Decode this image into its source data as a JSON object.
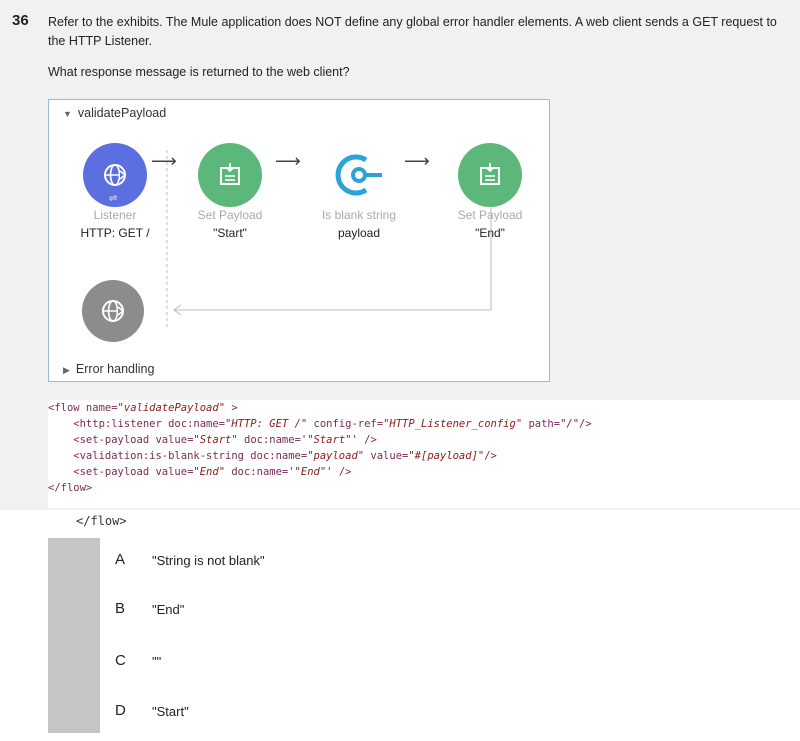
{
  "question": {
    "number": "36",
    "text": "Refer to the exhibits. The Mule application does NOT define any global error handler elements. A web client sends a GET request to the HTTP Listener.",
    "prompt": "What response message is returned to the web client?"
  },
  "flow_diagram": {
    "title": "validatePayload",
    "nodes": [
      {
        "label": "Listener",
        "sub": "HTTP: GET /",
        "icon": "globe-icon",
        "color": "#5b6fe0"
      },
      {
        "label": "Set Payload",
        "sub": "\"Start\"",
        "icon": "set-payload-icon",
        "color": "#5cb87a"
      },
      {
        "label": "Is blank string",
        "sub": "payload",
        "icon": "validation-icon",
        "color": "#2aa3d8"
      },
      {
        "label": "Set Payload",
        "sub": "\"End\"",
        "icon": "set-payload-icon",
        "color": "#5cb87a"
      }
    ],
    "response_node_icon": "globe-icon",
    "response_node_color": "#8c8c8c",
    "error_handling_label": "Error handling"
  },
  "code": {
    "line1_open": "<flow name=",
    "line1_name": "\"validatePayload\"",
    "line1_close": " >",
    "line2_a": "    <http:listener doc:name=",
    "line2_b": "\"HTTP: GET /\"",
    "line2_c": " config-ref=",
    "line2_d": "\"HTTP_Listener_config\"",
    "line2_e": " path=",
    "line2_f": "\"/\"",
    "line2_g": "/>",
    "line3_a": "    <set-payload value=",
    "line3_b": "\"Start\"",
    "line3_c": " doc:name=",
    "line3_d": "'\"Start\"'",
    "line3_e": " />",
    "line4_a": "    <validation:is-blank-string doc:name=",
    "line4_b": "\"payload\"",
    "line4_c": " value=",
    "line4_d": "\"#[payload]\"",
    "line4_e": "/>",
    "line5_a": "    <set-payload value=",
    "line5_b": "\"End\"",
    "line5_c": " doc:name=",
    "line5_d": "'\"End\"'",
    "line5_e": " />",
    "line6": "</flow>",
    "trailing": "</flow>"
  },
  "options": [
    {
      "letter": "A",
      "text": "\"String is not blank\""
    },
    {
      "letter": "B",
      "text": "\"End\""
    },
    {
      "letter": "C",
      "text": "\"\""
    },
    {
      "letter": "D",
      "text": "\"Start\""
    }
  ]
}
